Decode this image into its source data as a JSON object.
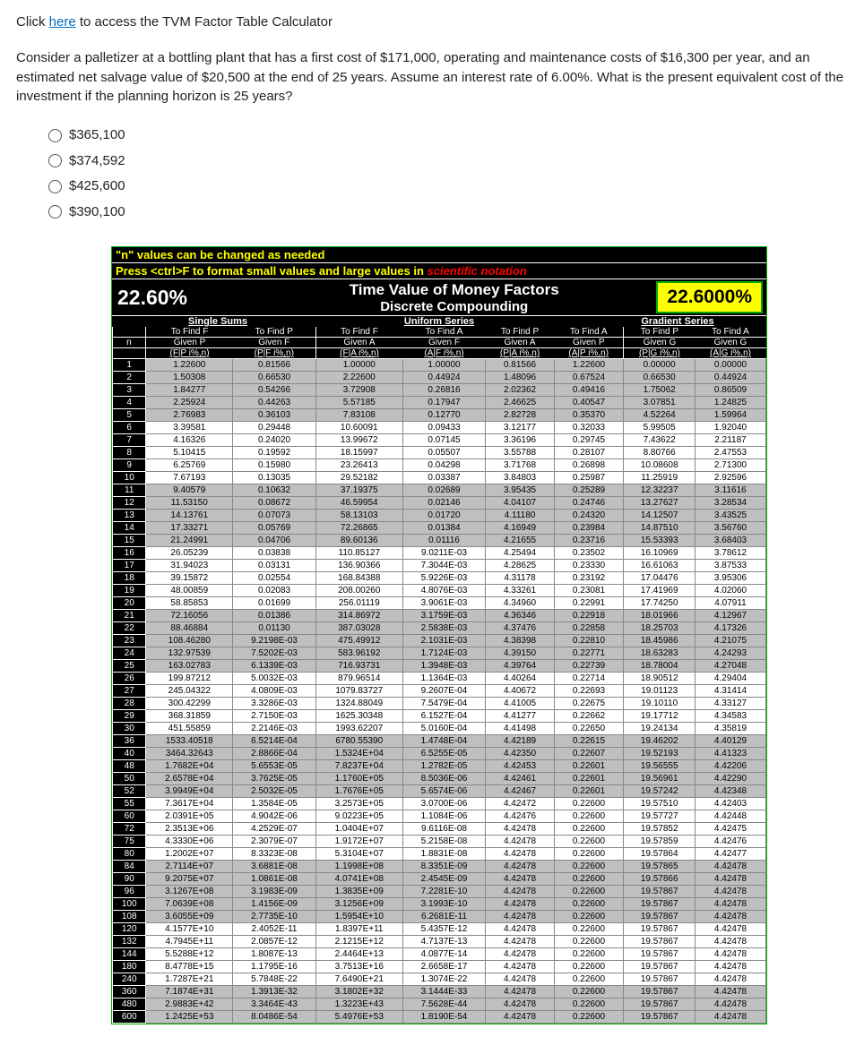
{
  "intro": {
    "click": "Click ",
    "here": "here",
    "after": " to access the TVM Factor Table Calculator",
    "question": "Consider a palletizer at a bottling plant that has a first cost of $171,000, operating and maintenance costs of $16,300 per year, and an estimated net salvage value of $20,500 at the end of 25 years. Assume an interest rate of 6.00%. What is the present equivalent cost of the investment if the planning horizon is 25 years?"
  },
  "options": [
    "$365,100",
    "$374,592",
    "$425,600",
    "$390,100"
  ],
  "table": {
    "hdr1": "\"n\" values can be changed as needed",
    "hdr2a": "Press <ctrl>F to format small values and large values in ",
    "hdr2b": "scientific notation",
    "rate_left": "22.60%",
    "title1": "Time Value of Money Factors",
    "title2": "Discrete Compounding",
    "rate_right": "22.6000%",
    "groups": [
      "Single Sums",
      "Uniform Series",
      "Gradient Series"
    ],
    "colhdrs": [
      {
        "l1": "",
        "l2": "n",
        "l3": ""
      },
      {
        "l1": "To Find F",
        "l2": "Given P",
        "l3": "(F|P i%,n)"
      },
      {
        "l1": "To Find P",
        "l2": "Given F",
        "l3": "(P|F i%,n)"
      },
      {
        "l1": "To Find F",
        "l2": "Given A",
        "l3": "(F|A i%,n)"
      },
      {
        "l1": "To Find A",
        "l2": "Given F",
        "l3": "(A|F i%,n)"
      },
      {
        "l1": "To Find P",
        "l2": "Given A",
        "l3": "(P|A i%,n)"
      },
      {
        "l1": "To Find A",
        "l2": "Given P",
        "l3": "(A|P i%,n)"
      },
      {
        "l1": "To Find P",
        "l2": "Given G",
        "l3": "(P|G i%,n)"
      },
      {
        "l1": "To Find A",
        "l2": "Given G",
        "l3": "(A|G i%,n)"
      }
    ],
    "rows": [
      [
        "1",
        "1.22600",
        "0.81566",
        "1.00000",
        "1.00000",
        "0.81566",
        "1.22600",
        "0.00000",
        "0.00000"
      ],
      [
        "2",
        "1.50308",
        "0.66530",
        "2.22600",
        "0.44924",
        "1.48096",
        "0.67524",
        "0.66530",
        "0.44924"
      ],
      [
        "3",
        "1.84277",
        "0.54266",
        "3.72908",
        "0.26816",
        "2.02362",
        "0.49416",
        "1.75062",
        "0.86509"
      ],
      [
        "4",
        "2.25924",
        "0.44263",
        "5.57185",
        "0.17947",
        "2.46625",
        "0.40547",
        "3.07851",
        "1.24825"
      ],
      [
        "5",
        "2.76983",
        "0.36103",
        "7.83108",
        "0.12770",
        "2.82728",
        "0.35370",
        "4.52264",
        "1.59964"
      ],
      [
        "6",
        "3.39581",
        "0.29448",
        "10.60091",
        "0.09433",
        "3.12177",
        "0.32033",
        "5.99505",
        "1.92040"
      ],
      [
        "7",
        "4.16326",
        "0.24020",
        "13.99672",
        "0.07145",
        "3.36196",
        "0.29745",
        "7.43622",
        "2.21187"
      ],
      [
        "8",
        "5.10415",
        "0.19592",
        "18.15997",
        "0.05507",
        "3.55788",
        "0.28107",
        "8.80766",
        "2.47553"
      ],
      [
        "9",
        "6.25769",
        "0.15980",
        "23.26413",
        "0.04298",
        "3.71768",
        "0.26898",
        "10.08608",
        "2.71300"
      ],
      [
        "10",
        "7.67193",
        "0.13035",
        "29.52182",
        "0.03387",
        "3.84803",
        "0.25987",
        "11.25919",
        "2.92596"
      ],
      [
        "11",
        "9.40579",
        "0.10632",
        "37.19375",
        "0.02689",
        "3.95435",
        "0.25289",
        "12.32237",
        "3.11616"
      ],
      [
        "12",
        "11.53150",
        "0.08672",
        "46.59954",
        "0.02146",
        "4.04107",
        "0.24746",
        "13.27627",
        "3.28534"
      ],
      [
        "13",
        "14.13761",
        "0.07073",
        "58.13103",
        "0.01720",
        "4.11180",
        "0.24320",
        "14.12507",
        "3.43525"
      ],
      [
        "14",
        "17.33271",
        "0.05769",
        "72.26865",
        "0.01384",
        "4.16949",
        "0.23984",
        "14.87510",
        "3.56760"
      ],
      [
        "15",
        "21.24991",
        "0.04706",
        "89.60136",
        "0.01116",
        "4.21655",
        "0.23716",
        "15.53393",
        "3.68403"
      ],
      [
        "16",
        "26.05239",
        "0.03838",
        "110.85127",
        "9.0211E-03",
        "4.25494",
        "0.23502",
        "16.10969",
        "3.78612"
      ],
      [
        "17",
        "31.94023",
        "0.03131",
        "136.90366",
        "7.3044E-03",
        "4.28625",
        "0.23330",
        "16.61063",
        "3.87533"
      ],
      [
        "18",
        "39.15872",
        "0.02554",
        "168.84388",
        "5.9226E-03",
        "4.31178",
        "0.23192",
        "17.04476",
        "3.95306"
      ],
      [
        "19",
        "48.00859",
        "0.02083",
        "208.00260",
        "4.8076E-03",
        "4.33261",
        "0.23081",
        "17.41969",
        "4.02060"
      ],
      [
        "20",
        "58.85853",
        "0.01699",
        "256.01119",
        "3.9061E-03",
        "4.34960",
        "0.22991",
        "17.74250",
        "4.07911"
      ],
      [
        "21",
        "72.16056",
        "0.01386",
        "314.86972",
        "3.1759E-03",
        "4.36346",
        "0.22918",
        "18.01966",
        "4.12967"
      ],
      [
        "22",
        "88.46884",
        "0.01130",
        "387.03028",
        "2.5838E-03",
        "4.37476",
        "0.22858",
        "18.25703",
        "4.17326"
      ],
      [
        "23",
        "108.46280",
        "9.2198E-03",
        "475.49912",
        "2.1031E-03",
        "4.38398",
        "0.22810",
        "18.45986",
        "4.21075"
      ],
      [
        "24",
        "132.97539",
        "7.5202E-03",
        "583.96192",
        "1.7124E-03",
        "4.39150",
        "0.22771",
        "18.63283",
        "4.24293"
      ],
      [
        "25",
        "163.02783",
        "6.1339E-03",
        "716.93731",
        "1.3948E-03",
        "4.39764",
        "0.22739",
        "18.78004",
        "4.27048"
      ],
      [
        "26",
        "199.87212",
        "5.0032E-03",
        "879.96514",
        "1.1364E-03",
        "4.40264",
        "0.22714",
        "18.90512",
        "4.29404"
      ],
      [
        "27",
        "245.04322",
        "4.0809E-03",
        "1079.83727",
        "9.2607E-04",
        "4.40672",
        "0.22693",
        "19.01123",
        "4.31414"
      ],
      [
        "28",
        "300.42299",
        "3.3286E-03",
        "1324.88049",
        "7.5479E-04",
        "4.41005",
        "0.22675",
        "19.10110",
        "4.33127"
      ],
      [
        "29",
        "368.31859",
        "2.7150E-03",
        "1625.30348",
        "6.1527E-04",
        "4.41277",
        "0.22662",
        "19.17712",
        "4.34583"
      ],
      [
        "30",
        "451.55859",
        "2.2146E-03",
        "1993.62207",
        "5.0160E-04",
        "4.41498",
        "0.22650",
        "19.24134",
        "4.35819"
      ],
      [
        "36",
        "1533.40518",
        "6.5214E-04",
        "6780.55390",
        "1.4748E-04",
        "4.42189",
        "0.22615",
        "19.46202",
        "4.40129"
      ],
      [
        "40",
        "3464.32643",
        "2.8866E-04",
        "1.5324E+04",
        "6.5255E-05",
        "4.42350",
        "0.22607",
        "19.52193",
        "4.41323"
      ],
      [
        "48",
        "1.7682E+04",
        "5.6553E-05",
        "7.8237E+04",
        "1.2782E-05",
        "4.42453",
        "0.22601",
        "19.56555",
        "4.42206"
      ],
      [
        "50",
        "2.6578E+04",
        "3.7625E-05",
        "1.1760E+05",
        "8.5036E-06",
        "4.42461",
        "0.22601",
        "19.56961",
        "4.42290"
      ],
      [
        "52",
        "3.9949E+04",
        "2.5032E-05",
        "1.7676E+05",
        "5.6574E-06",
        "4.42467",
        "0.22601",
        "19.57242",
        "4.42348"
      ],
      [
        "55",
        "7.3617E+04",
        "1.3584E-05",
        "3.2573E+05",
        "3.0700E-06",
        "4.42472",
        "0.22600",
        "19.57510",
        "4.42403"
      ],
      [
        "60",
        "2.0391E+05",
        "4.9042E-06",
        "9.0223E+05",
        "1.1084E-06",
        "4.42476",
        "0.22600",
        "19.57727",
        "4.42448"
      ],
      [
        "72",
        "2.3513E+06",
        "4.2529E-07",
        "1.0404E+07",
        "9.6116E-08",
        "4.42478",
        "0.22600",
        "19.57852",
        "4.42475"
      ],
      [
        "75",
        "4.3330E+06",
        "2.3079E-07",
        "1.9172E+07",
        "5.2158E-08",
        "4.42478",
        "0.22600",
        "19.57859",
        "4.42476"
      ],
      [
        "80",
        "1.2002E+07",
        "8.3323E-08",
        "5.3104E+07",
        "1.8831E-08",
        "4.42478",
        "0.22600",
        "19.57864",
        "4.42477"
      ],
      [
        "84",
        "2.7114E+07",
        "3.6881E-08",
        "1.1998E+08",
        "8.3351E-09",
        "4.42478",
        "0.22600",
        "19.57865",
        "4.42478"
      ],
      [
        "90",
        "9.2075E+07",
        "1.0861E-08",
        "4.0741E+08",
        "2.4545E-09",
        "4.42478",
        "0.22600",
        "19.57866",
        "4.42478"
      ],
      [
        "96",
        "3.1267E+08",
        "3.1983E-09",
        "1.3835E+09",
        "7.2281E-10",
        "4.42478",
        "0.22600",
        "19.57867",
        "4.42478"
      ],
      [
        "100",
        "7.0639E+08",
        "1.4156E-09",
        "3.1256E+09",
        "3.1993E-10",
        "4.42478",
        "0.22600",
        "19.57867",
        "4.42478"
      ],
      [
        "108",
        "3.6055E+09",
        "2.7735E-10",
        "1.5954E+10",
        "6.2681E-11",
        "4.42478",
        "0.22600",
        "19.57867",
        "4.42478"
      ],
      [
        "120",
        "4.1577E+10",
        "2.4052E-11",
        "1.8397E+11",
        "5.4357E-12",
        "4.42478",
        "0.22600",
        "19.57867",
        "4.42478"
      ],
      [
        "132",
        "4.7945E+11",
        "2.0857E-12",
        "2.1215E+12",
        "4.7137E-13",
        "4.42478",
        "0.22600",
        "19.57867",
        "4.42478"
      ],
      [
        "144",
        "5.5288E+12",
        "1.8087E-13",
        "2.4464E+13",
        "4.0877E-14",
        "4.42478",
        "0.22600",
        "19.57867",
        "4.42478"
      ],
      [
        "180",
        "8.4778E+15",
        "1.1795E-16",
        "3.7513E+16",
        "2.6658E-17",
        "4.42478",
        "0.22600",
        "19.57867",
        "4.42478"
      ],
      [
        "240",
        "1.7287E+21",
        "5.7848E-22",
        "7.6490E+21",
        "1.3074E-22",
        "4.42478",
        "0.22600",
        "19.57867",
        "4.42478"
      ],
      [
        "360",
        "7.1874E+31",
        "1.3913E-32",
        "3.1802E+32",
        "3.1444E-33",
        "4.42478",
        "0.22600",
        "19.57867",
        "4.42478"
      ],
      [
        "480",
        "2.9883E+42",
        "3.3464E-43",
        "1.3223E+43",
        "7.5628E-44",
        "4.42478",
        "0.22600",
        "19.57867",
        "4.42478"
      ],
      [
        "600",
        "1.2425E+53",
        "8.0486E-54",
        "5.4976E+53",
        "1.8190E-54",
        "4.42478",
        "0.22600",
        "19.57867",
        "4.42478"
      ]
    ],
    "bands": [
      [
        0,
        4
      ],
      [
        10,
        14
      ],
      [
        20,
        24
      ],
      [
        30,
        34
      ],
      [
        40,
        44
      ],
      [
        50,
        52
      ]
    ]
  }
}
